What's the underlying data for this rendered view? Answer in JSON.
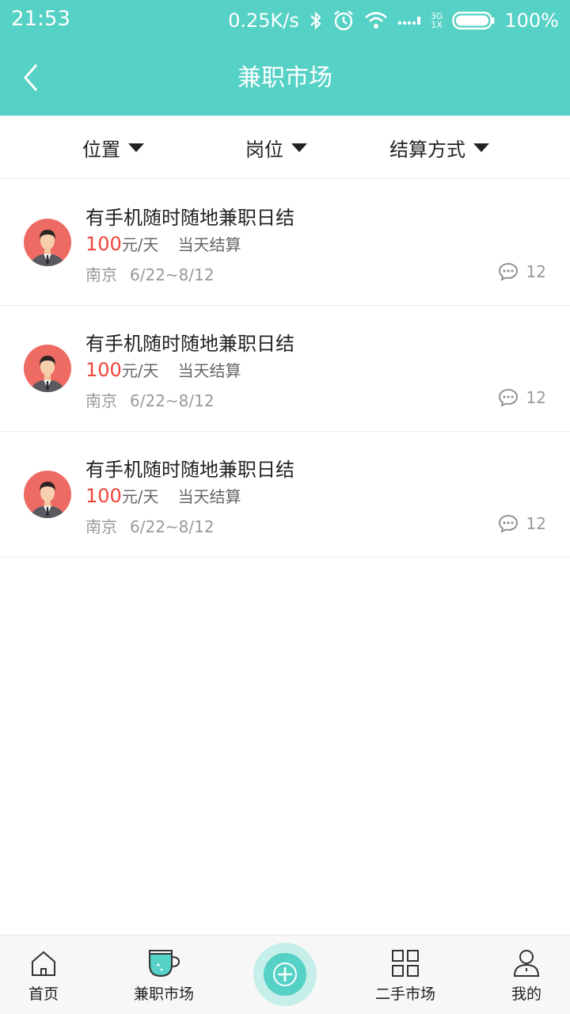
{
  "status_bar": {
    "time": "21:53",
    "net_speed": "0.25K/s",
    "signal_top": "3G",
    "signal_bottom": "1X",
    "battery": "100%"
  },
  "header": {
    "title": "兼职市场"
  },
  "filters": [
    {
      "label": "位置"
    },
    {
      "label": "岗位"
    },
    {
      "label": "结算方式"
    }
  ],
  "listings": [
    {
      "title": "有手机随时随地兼职日结",
      "price": "100",
      "unit": "元/天",
      "settlement": "当天结算",
      "city": "南京",
      "date": "6/22~8/12",
      "comments": "12"
    },
    {
      "title": "有手机随时随地兼职日结",
      "price": "100",
      "unit": "元/天",
      "settlement": "当天结算",
      "city": "南京",
      "date": "6/22~8/12",
      "comments": "12"
    },
    {
      "title": "有手机随时随地兼职日结",
      "price": "100",
      "unit": "元/天",
      "settlement": "当天结算",
      "city": "南京",
      "date": "6/22~8/12",
      "comments": "12"
    }
  ],
  "tabbar": {
    "home": "首页",
    "parttime": "兼职市场",
    "secondhand": "二手市场",
    "mine": "我的"
  },
  "colors": {
    "accent": "#56d1c5",
    "price": "#f0453a",
    "avatar_bg": "#ee6b64"
  }
}
